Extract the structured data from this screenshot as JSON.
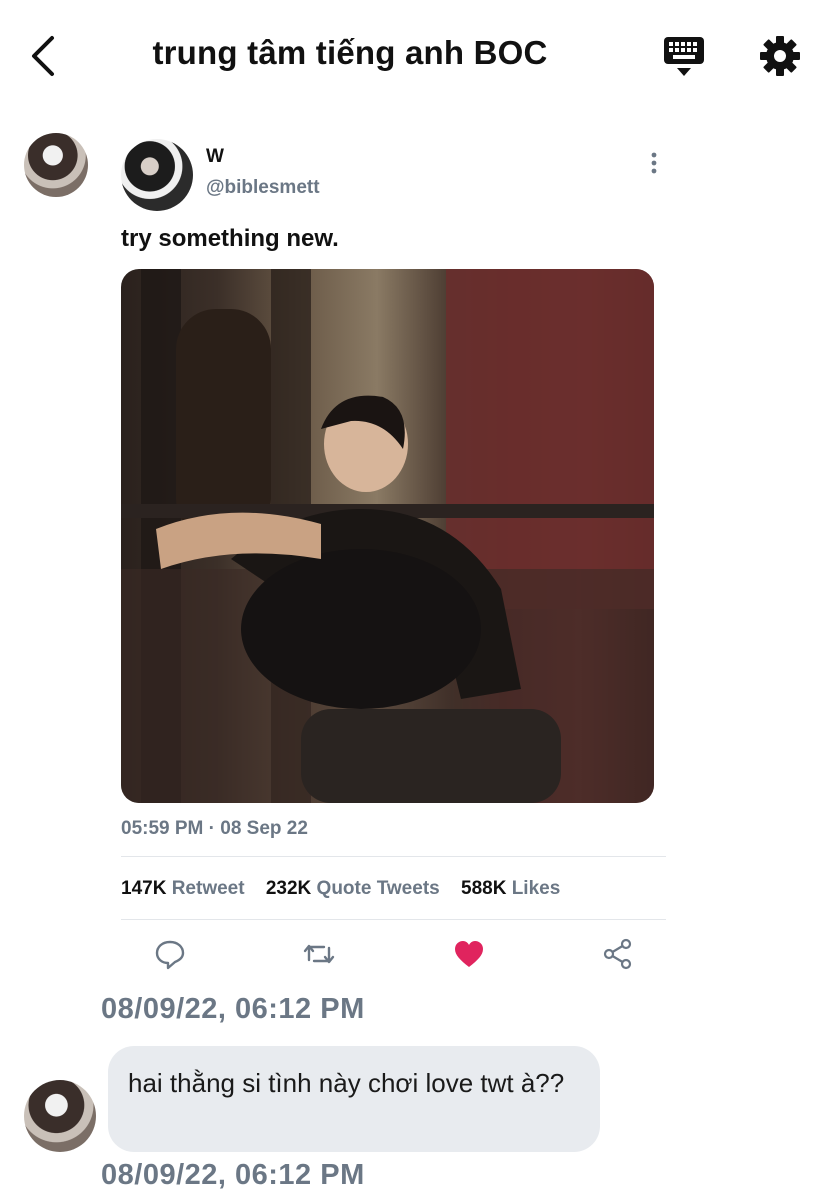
{
  "header": {
    "title": "trung tâm tiếng anh BOC",
    "back_icon": "chevron-left-icon",
    "keyboard_icon": "keyboard-icon",
    "settings_icon": "gear-icon"
  },
  "tweet": {
    "name": "W",
    "handle": "@biblesmett",
    "text": "try something new.",
    "time": "05:59 PM · 08 Sep 22",
    "stats": [
      {
        "count": "147K",
        "label": "Retweet"
      },
      {
        "count": "232K",
        "label": "Quote Tweets"
      },
      {
        "count": "588K",
        "label": "Likes"
      }
    ],
    "actions": [
      "reply-icon",
      "retweet-icon",
      "heart-icon",
      "share-icon"
    ],
    "like_color": "#e0245e"
  },
  "messages": [
    {
      "timestamp": "08/09/22, 06:12 PM"
    },
    {
      "text": "hai thằng si tình này chơi love twt à??",
      "timestamp": "08/09/22, 06:12 PM"
    }
  ],
  "colors": {
    "muted": "#6b7785",
    "bubble": "#e8ebef"
  }
}
